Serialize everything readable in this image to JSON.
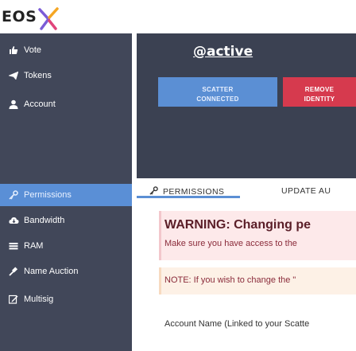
{
  "brand": {
    "logo_text": "EOS",
    "accent_x_colors": [
      "#7b5cd6",
      "#e0457b",
      "#f5a623"
    ]
  },
  "sidebar": {
    "items": [
      {
        "label": "Vote",
        "icon": "thumbs-up-icon",
        "active": false
      },
      {
        "label": "Tokens",
        "icon": "paper-plane-icon",
        "active": false
      },
      {
        "label": "Account",
        "icon": "user-icon",
        "active": false
      },
      {
        "label": "Permissions",
        "icon": "key-icon",
        "active": true
      },
      {
        "label": "Bandwidth",
        "icon": "cloud-icon",
        "active": false
      },
      {
        "label": "RAM",
        "icon": "memory-icon",
        "active": false
      },
      {
        "label": "Name Auction",
        "icon": "gavel-icon",
        "active": false
      },
      {
        "label": "Multisig",
        "icon": "edit-icon",
        "active": false
      }
    ]
  },
  "header": {
    "username": "@active",
    "scatter_button": "SCATTER\nCONNECTED",
    "remove_button": "REMOVE\nIDENTITY"
  },
  "tabs": {
    "permissions": "PERMISSIONS",
    "update": "UPDATE AU"
  },
  "content": {
    "warning_title": "WARNING: Changing pe",
    "warning_text": "Make sure you have access to the",
    "note_text": "NOTE: If you wish to change the \"",
    "account_label": "Account Name (Linked to your Scatte"
  },
  "colors": {
    "sidebar_bg": "#414759",
    "active_item": "#5a8fd6",
    "remove_red": "#d63a4e",
    "accent_blue": "#5b8fd4"
  }
}
